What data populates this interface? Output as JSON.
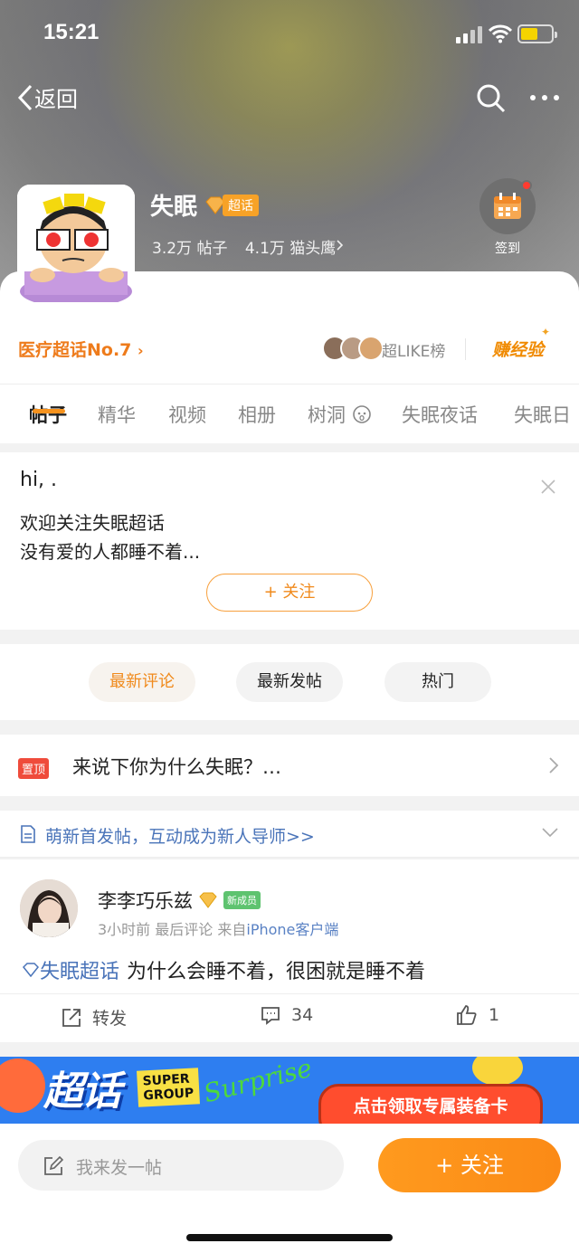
{
  "status_bar": {
    "time": "15:21"
  },
  "nav": {
    "back_label": "返回"
  },
  "header": {
    "topic_name": "失眠",
    "badge_label": "超话",
    "posts_count": "3.2万 帖子",
    "followers_count": "4.1万 猫头鹰",
    "signin_label": "签到"
  },
  "rank_bar": {
    "rank_label": "医疗超话No.7",
    "like_label": "超LIKE榜",
    "earn_label": "赚经验"
  },
  "tabs": [
    "帖子",
    "精华",
    "视频",
    "相册",
    "树洞",
    "失眠夜话",
    "失眠日"
  ],
  "welcome": {
    "greeting": "hi, .",
    "line1": "欢迎关注失眠超话",
    "line2": "没有爱的人都睡不着...",
    "follow_label": "+ 关注"
  },
  "filters": [
    "最新评论",
    "最新发帖",
    "热门"
  ],
  "pinned": {
    "tag": "置顶",
    "text": "来说下你为什么失眠？…"
  },
  "newbie": {
    "text": "萌新首发帖，互动成为新人导师>>"
  },
  "post": {
    "username": "李李巧乐兹",
    "member_badge": "新成员",
    "meta_time": "3小时前 最后评论",
    "meta_from": "来自",
    "meta_client": "iPhone客户端",
    "topic_tag": "失眠超话",
    "content": "为什么会睡不着，很困就是睡不着",
    "repost_label": "转发",
    "comments": "34",
    "likes": "1"
  },
  "banner": {
    "logo": "超话",
    "super_line1": "SUPER",
    "super_line2": "GROUP",
    "surprise": "Surprise",
    "cta": "点击领取专属装备卡"
  },
  "bottom": {
    "compose_placeholder": "我来发一帖",
    "follow_label": "+ 关注"
  },
  "colors": {
    "accent": "#f7931e",
    "link": "#4a74b9",
    "pin": "#ef4b3b"
  }
}
